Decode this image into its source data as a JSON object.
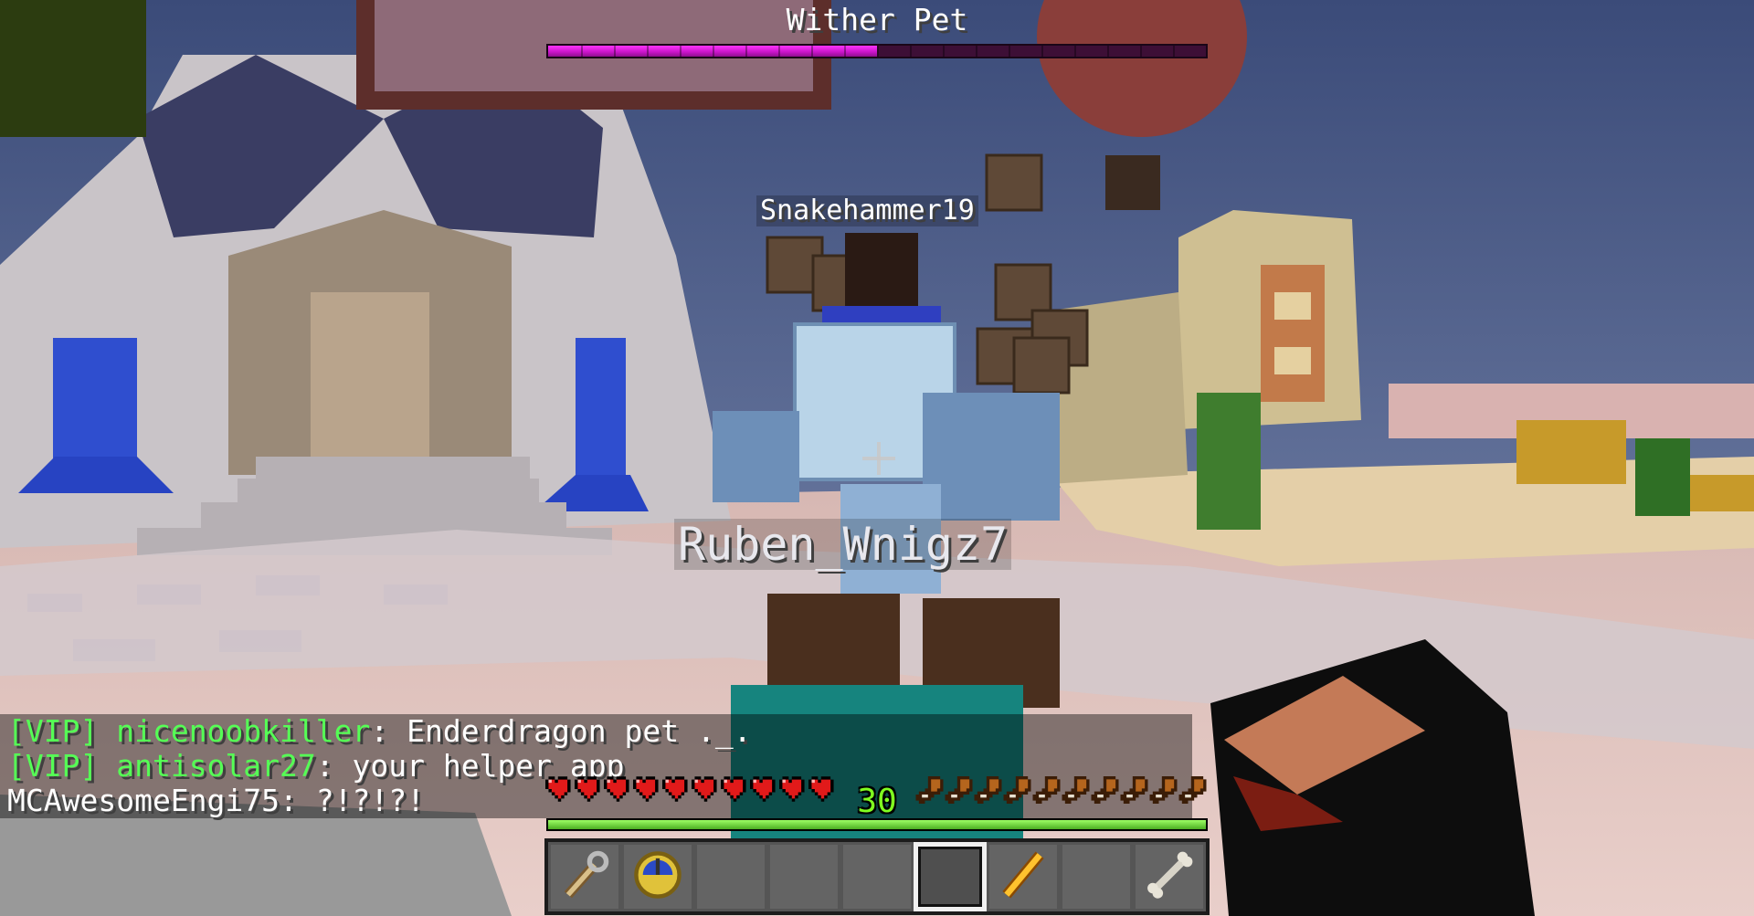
{
  "boss_bar": {
    "title": "Wither Pet",
    "health_fraction": 0.5,
    "color": "#ff33ff"
  },
  "nametags": {
    "player_top": "Snakehammer19",
    "pet_owner": "Ruben_Wnigz7"
  },
  "chat": {
    "lines": [
      {
        "rank": "[VIP] ",
        "name": "nicenoobkiller",
        "message": ": Enderdragon pet ._."
      },
      {
        "rank": "[VIP] ",
        "name": "antisolar27",
        "message": ": your helper app"
      },
      {
        "rank": "",
        "name": "MCAwesomeEngi75",
        "message": ": ?!?!?!"
      }
    ]
  },
  "hud": {
    "hearts": 10,
    "hunger": 10,
    "xp_level": "30",
    "xp_fraction": 1.0,
    "hotbar": {
      "selected_slot": 5,
      "slots": [
        {
          "icon": "lead-icon"
        },
        {
          "icon": "clock-icon"
        },
        {
          "icon": "empty"
        },
        {
          "icon": "empty"
        },
        {
          "icon": "empty"
        },
        {
          "icon": "empty"
        },
        {
          "icon": "blaze-rod-icon"
        },
        {
          "icon": "empty"
        },
        {
          "icon": "bone-icon"
        }
      ]
    }
  },
  "colors": {
    "sky": "#5b6c95",
    "sand": "#e0cba4",
    "quartz": "#d8d2d4",
    "hunger": "#b5651d",
    "heart": "#e11a1a"
  }
}
